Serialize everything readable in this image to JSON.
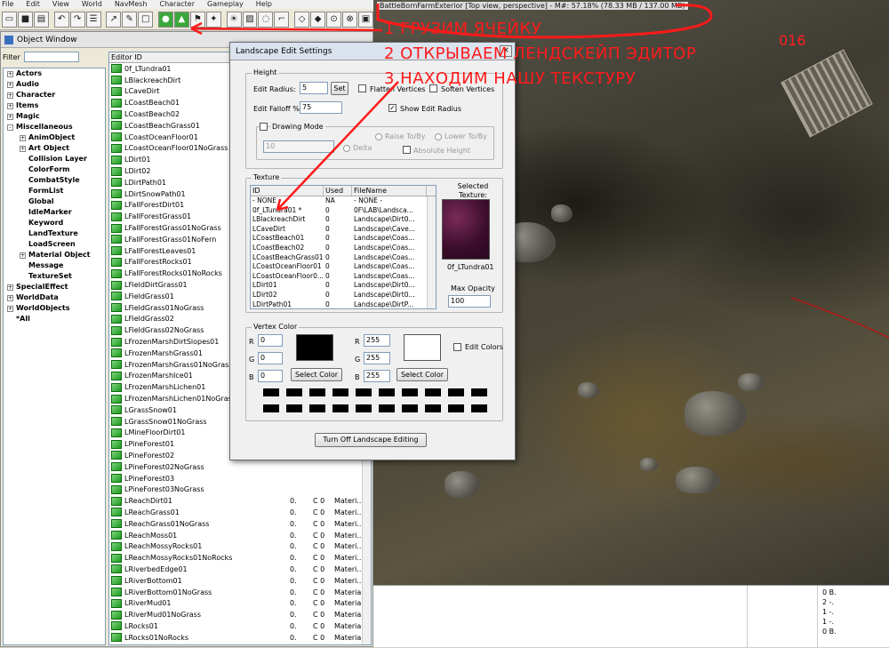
{
  "menu": [
    "File",
    "Edit",
    "View",
    "World",
    "NavMesh",
    "Character",
    "Gameplay",
    "Help"
  ],
  "viewport": {
    "title": "BattleBornFarmExterior [Top view, perspective] - M#: 57.18% (78.33 MB / 137.00 MB)"
  },
  "annotations": {
    "step1": "1 ГРУЗИМ ЯЧЕЙКУ",
    "step2": "2 ОТКРЫВАЕМ ЛЕНДСКЕЙП ЭДИТОР",
    "step3": "3 НАХОДИМ НАШУ ТЕКСТУРУ",
    "number": "016",
    "color": "#ff1a1a"
  },
  "object_window": {
    "title": "Object Window",
    "filter_label": "Filter",
    "filter_value": "",
    "tree": [
      {
        "label": "Actors",
        "expander": "+",
        "indent": 0
      },
      {
        "label": "Audio",
        "expander": "+",
        "indent": 0
      },
      {
        "label": "Character",
        "expander": "+",
        "indent": 0
      },
      {
        "label": "Items",
        "expander": "+",
        "indent": 0
      },
      {
        "label": "Magic",
        "expander": "+",
        "indent": 0
      },
      {
        "label": "Miscellaneous",
        "expander": "-",
        "indent": 0
      },
      {
        "label": "AnimObject",
        "expander": "+",
        "indent": 1
      },
      {
        "label": "Art Object",
        "expander": "+",
        "indent": 1
      },
      {
        "label": "Collision Layer",
        "expander": "",
        "indent": 1
      },
      {
        "label": "ColorForm",
        "expander": "",
        "indent": 1
      },
      {
        "label": "CombatStyle",
        "expander": "",
        "indent": 1
      },
      {
        "label": "FormList",
        "expander": "",
        "indent": 1
      },
      {
        "label": "Global",
        "expander": "",
        "indent": 1
      },
      {
        "label": "IdleMarker",
        "expander": "",
        "indent": 1
      },
      {
        "label": "Keyword",
        "expander": "",
        "indent": 1
      },
      {
        "label": "LandTexture",
        "expander": "",
        "indent": 1
      },
      {
        "label": "LoadScreen",
        "expander": "",
        "indent": 1
      },
      {
        "label": "Material Object",
        "expander": "+",
        "indent": 1
      },
      {
        "label": "Message",
        "expander": "",
        "indent": 1
      },
      {
        "label": "TextureSet",
        "expander": "",
        "indent": 1
      },
      {
        "label": "SpecialEffect",
        "expander": "+",
        "indent": 0
      },
      {
        "label": "WorldData",
        "expander": "+",
        "indent": 0
      },
      {
        "label": "WorldObjects",
        "expander": "+",
        "indent": 0
      },
      {
        "label": "*All",
        "expander": "",
        "indent": 0
      }
    ],
    "list_header": [
      "Editor ID",
      "",
      "",
      ""
    ],
    "list_rows": [
      {
        "name": "0f_LTundra01"
      },
      {
        "name": "LBlackreachDirt"
      },
      {
        "name": "LCaveDirt"
      },
      {
        "name": "LCoastBeach01"
      },
      {
        "name": "LCoastBeach02"
      },
      {
        "name": "LCoastBeachGrass01"
      },
      {
        "name": "LCoastOceanFloor01"
      },
      {
        "name": "LCoastOceanFloor01NoGrass"
      },
      {
        "name": "LDirt01"
      },
      {
        "name": "LDirt02"
      },
      {
        "name": "LDirtPath01"
      },
      {
        "name": "LDirtSnowPath01"
      },
      {
        "name": "LFallForestDirt01"
      },
      {
        "name": "LFallForestGrass01"
      },
      {
        "name": "LFallForestGrass01NoGrass"
      },
      {
        "name": "LFallForestGrass01NoFern"
      },
      {
        "name": "LFallForestLeaves01"
      },
      {
        "name": "LFallForestRocks01"
      },
      {
        "name": "LFallForestRocks01NoRocks"
      },
      {
        "name": "LFieldDirtGrass01"
      },
      {
        "name": "LFieldGrass01"
      },
      {
        "name": "LFieldGrass01NoGrass"
      },
      {
        "name": "LFieldGrass02"
      },
      {
        "name": "LFieldGrass02NoGrass"
      },
      {
        "name": "LFrozenMarshDirtSlopes01"
      },
      {
        "name": "LFrozenMarshGrass01"
      },
      {
        "name": "LFrozenMarshGrass01NoGrass"
      },
      {
        "name": "LFrozenMarshIce01"
      },
      {
        "name": "LFrozenMarshLichen01"
      },
      {
        "name": "LFrozenMarshLichen01NoGrass"
      },
      {
        "name": "LGrassSnow01"
      },
      {
        "name": "LGrassSnow01NoGrass"
      },
      {
        "name": "LMineFloorDirt01"
      },
      {
        "name": "LPineForest01"
      },
      {
        "name": "LPineForest02"
      },
      {
        "name": "LPineForest02NoGrass"
      },
      {
        "name": "LPineForest03"
      },
      {
        "name": "LPineForest03NoGrass"
      },
      {
        "name": "LReachDirt01",
        "c2": "0.",
        "c3": "C 0",
        "c4": "Materi..."
      },
      {
        "name": "LReachGrass01",
        "c2": "0.",
        "c3": "C 0",
        "c4": "Materi..."
      },
      {
        "name": "LReachGrass01NoGrass",
        "c2": "0.",
        "c3": "C 0",
        "c4": "Materi..."
      },
      {
        "name": "LReachMoss01",
        "c2": "0.",
        "c3": "C 0",
        "c4": "Materi..."
      },
      {
        "name": "LReachMossyRocks01",
        "c2": "0.",
        "c3": "C 0",
        "c4": "Materi..."
      },
      {
        "name": "LReachMossyRocks01NoRocks",
        "c2": "0.",
        "c3": "C 0",
        "c4": "Materi..."
      },
      {
        "name": "LRiverbedEdge01",
        "c2": "0.",
        "c3": "C 0",
        "c4": "Materi..."
      },
      {
        "name": "LRiverBottom01",
        "c2": "0.",
        "c3": "C 0",
        "c4": "Materi..."
      },
      {
        "name": "LRiverBottom01NoGrass",
        "c2": "0.",
        "c3": "C 0",
        "c4": "Material..."
      },
      {
        "name": "LRiverMud01",
        "c2": "0.",
        "c3": "C 0",
        "c4": "Material..."
      },
      {
        "name": "LRiverMud01NoGrass",
        "c2": "0.",
        "c3": "C 0",
        "c4": "Material..."
      },
      {
        "name": "LRocks01",
        "c2": "0.",
        "c3": "C 0",
        "c4": "Material..."
      },
      {
        "name": "LRocks01NoRocks",
        "c2": "0.",
        "c3": "C 0",
        "c4": "Material..."
      }
    ]
  },
  "dialog": {
    "title": "Landscape Edit Settings",
    "close_label": "×",
    "height_group": "Height",
    "edit_radius_label": "Edit Radius:",
    "edit_radius_value": "5",
    "set_label": "Set",
    "flatten_label": "Flatten Vertices",
    "soften_label": "Soften Vertices",
    "falloff_label": "Edit Falloff %:",
    "falloff_value": "75",
    "show_radius_label": "Show Edit Radius",
    "drawing_mode_label": "Drawing Mode",
    "drawing_value": "10",
    "raise_label": "Raise To/By",
    "lower_label": "Lower To/By",
    "delta_label": "Delta",
    "abs_height_label": "Absolute Height",
    "texture_group": "Texture",
    "tex_header": [
      "ID",
      "Used",
      "FileName"
    ],
    "tex_rows": [
      {
        "id": "- NONE -",
        "used": "NA",
        "file": "- NONE -"
      },
      {
        "id": "0f_LTundra01 *",
        "used": "0",
        "file": "0F\\LAB\\Landsca..."
      },
      {
        "id": "LBlackreachDirt",
        "used": "0",
        "file": "Landscape\\Dirt0..."
      },
      {
        "id": "LCaveDirt",
        "used": "0",
        "file": "Landscape\\Cave..."
      },
      {
        "id": "LCoastBeach01",
        "used": "0",
        "file": "Landscape\\Coas..."
      },
      {
        "id": "LCoastBeach02",
        "used": "0",
        "file": "Landscape\\Coas..."
      },
      {
        "id": "LCoastBeachGrass01",
        "used": "0",
        "file": "Landscape\\Coas..."
      },
      {
        "id": "LCoastOceanFloor01",
        "used": "0",
        "file": "Landscape\\Coas..."
      },
      {
        "id": "LCoastOceanFloor0...",
        "used": "0",
        "file": "Landscape\\Coas..."
      },
      {
        "id": "LDirt01",
        "used": "0",
        "file": "Landscape\\Dirt0..."
      },
      {
        "id": "LDirt02",
        "used": "0",
        "file": "Landscape\\Dirt0..."
      },
      {
        "id": "LDirtPath01",
        "used": "0",
        "file": "Landscape\\DirtP..."
      }
    ],
    "selected_texture_label": "Selected Texture:",
    "selected_texture_name": "0f_LTundra01",
    "max_opacity_label": "Max Opacity",
    "max_opacity_value": "100",
    "vertex_group": "Vertex Color",
    "r1": "0",
    "g1": "0",
    "b1": "0",
    "r2": "255",
    "g2": "255",
    "b2": "255",
    "R": "R",
    "G": "G",
    "B": "B",
    "select_color_label": "Select Color",
    "edit_colors_label": "Edit Colors",
    "turn_off_label": "Turn Off Landscape Editing"
  },
  "bottom_list": [
    "0 B.",
    "2 -.",
    "1 -.",
    "1 -.",
    "0 B."
  ]
}
